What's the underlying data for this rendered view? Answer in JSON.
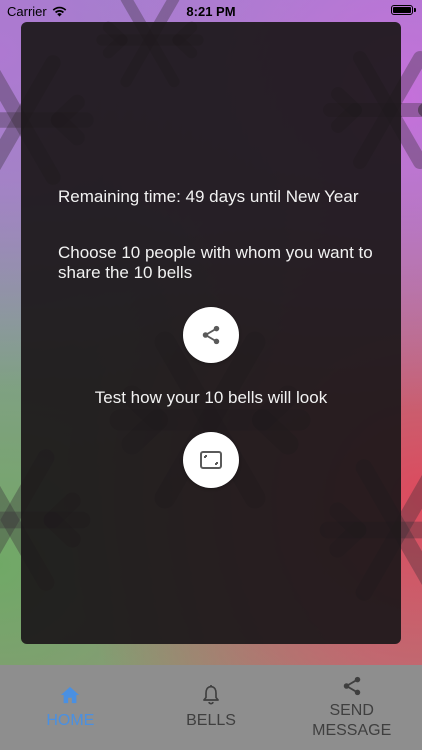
{
  "status_bar": {
    "carrier": "Carrier",
    "time": "8:21 PM"
  },
  "main": {
    "remaining_text": "Remaining time: 49 days until New Year",
    "choose_text": "Choose 10 people with whom you want to share the 10 bells",
    "test_text": "Test how your 10 bells will look",
    "share_icon": "share-icon",
    "preview_icon": "frame-preview-icon"
  },
  "tab_bar": {
    "active_color": "#4a90e2",
    "inactive_color": "#3f3f3f",
    "tabs": [
      {
        "label": "HOME",
        "icon": "home-icon",
        "active": true
      },
      {
        "label": "BELLS",
        "icon": "bell-icon",
        "active": false
      },
      {
        "label": "SEND\nMESSAGE",
        "icon": "share-icon",
        "active": false
      }
    ]
  }
}
